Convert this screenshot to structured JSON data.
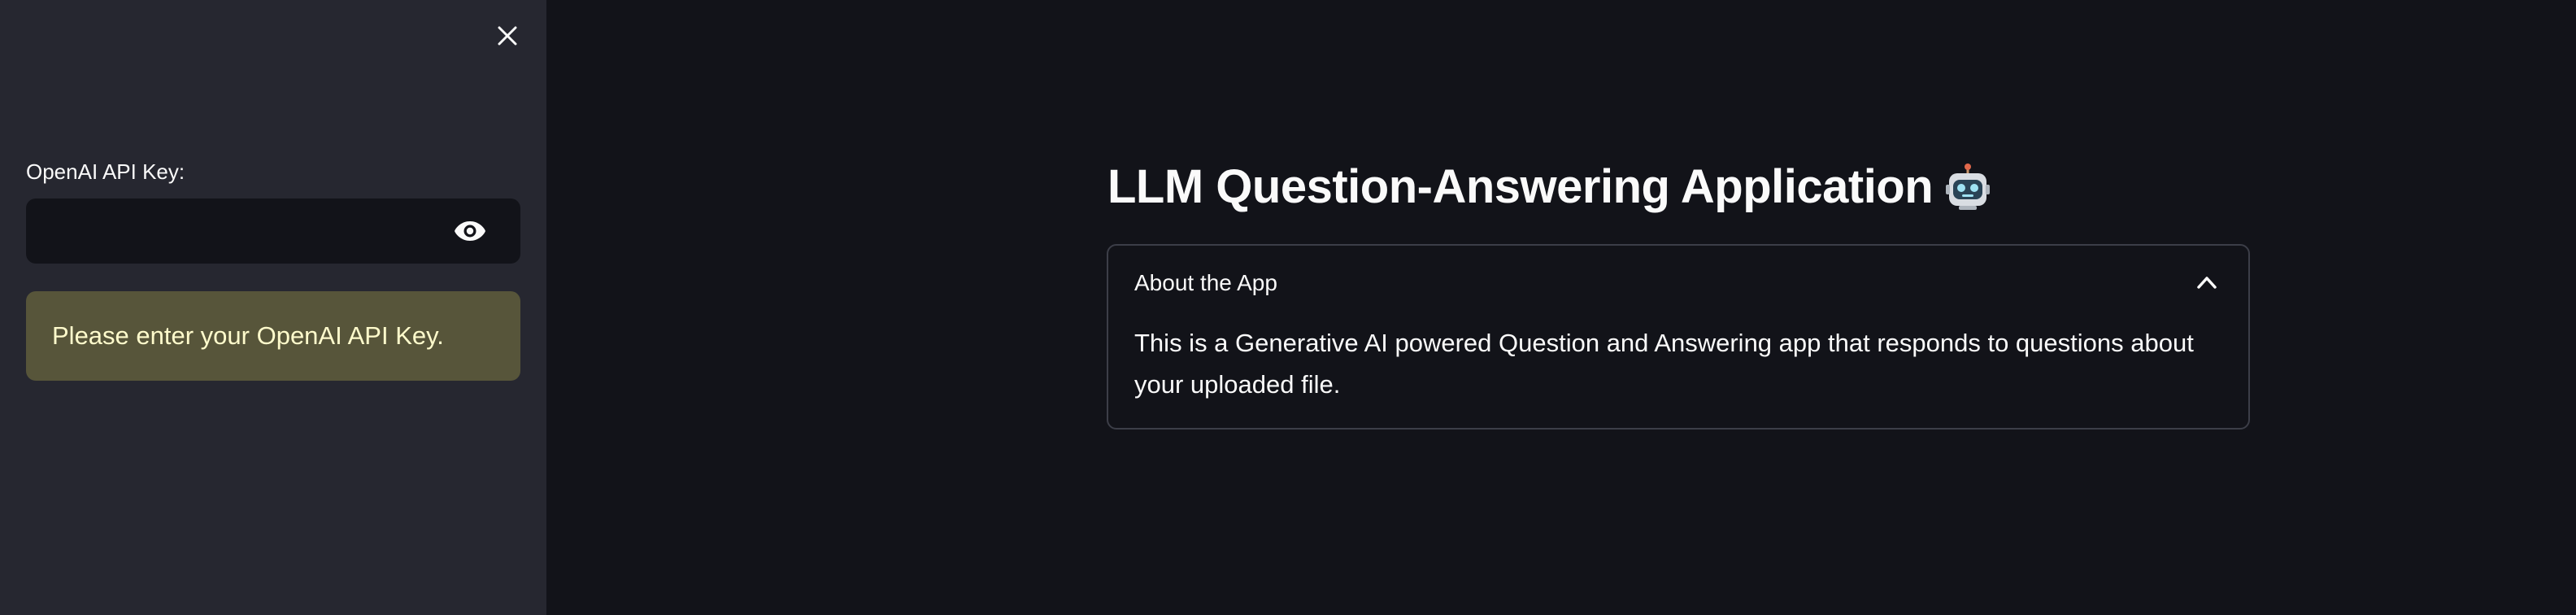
{
  "sidebar": {
    "close_icon": "close-icon",
    "api_key_label": "OpenAI API Key:",
    "api_key_value": "",
    "api_key_placeholder": "",
    "visibility_icon": "eye-icon",
    "warning_text": "Please enter your OpenAI API Key."
  },
  "main": {
    "title": "LLM Question-Answering Application",
    "title_emoji": "robot-icon",
    "expander": {
      "label": "About the App",
      "expanded": true,
      "chevron_icon": "chevron-up-icon",
      "body": "This is a Generative AI powered Question and Answering app that responds to questions about your uploaded file."
    }
  },
  "colors": {
    "sidebar_bg": "#262730",
    "main_bg": "#121319",
    "warning_bg": "#57553a",
    "warning_text": "#fffbcc",
    "text": "#fafafa",
    "border": "#3c3e48"
  }
}
